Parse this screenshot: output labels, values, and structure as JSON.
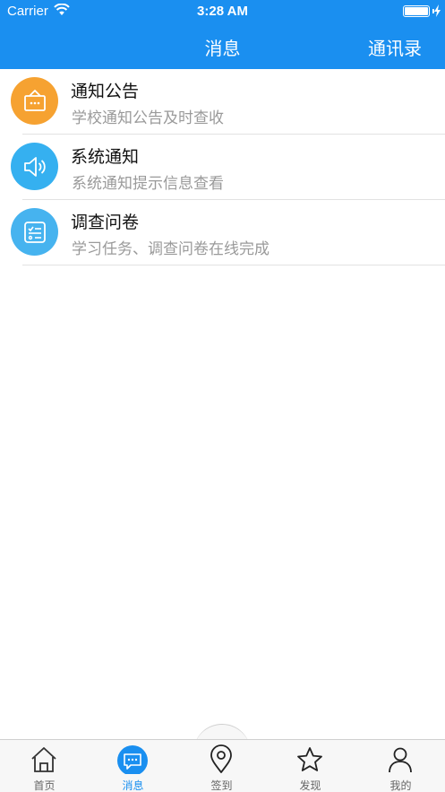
{
  "status_bar": {
    "carrier": "Carrier",
    "time": "3:28 AM"
  },
  "nav": {
    "title": "消息",
    "right_action": "通讯录"
  },
  "colors": {
    "primary": "#1a8ff0",
    "orange": "#f6a231",
    "light_blue": "#35b0f0",
    "sky_blue": "#46b3ef"
  },
  "items": [
    {
      "title": "通知公告",
      "subtitle": "学校通知公告及时查收",
      "icon": "notice-board-icon"
    },
    {
      "title": "系统通知",
      "subtitle": "系统通知提示信息查看",
      "icon": "speaker-icon"
    },
    {
      "title": "调查问卷",
      "subtitle": "学习任务、调查问卷在线完成",
      "icon": "checklist-icon"
    }
  ],
  "tabs": [
    {
      "label": "首页",
      "icon": "home-icon",
      "active": false
    },
    {
      "label": "消息",
      "icon": "message-icon",
      "active": true
    },
    {
      "label": "签到",
      "icon": "location-pin-icon",
      "active": false
    },
    {
      "label": "发现",
      "icon": "star-icon",
      "active": false
    },
    {
      "label": "我的",
      "icon": "person-icon",
      "active": false
    }
  ]
}
